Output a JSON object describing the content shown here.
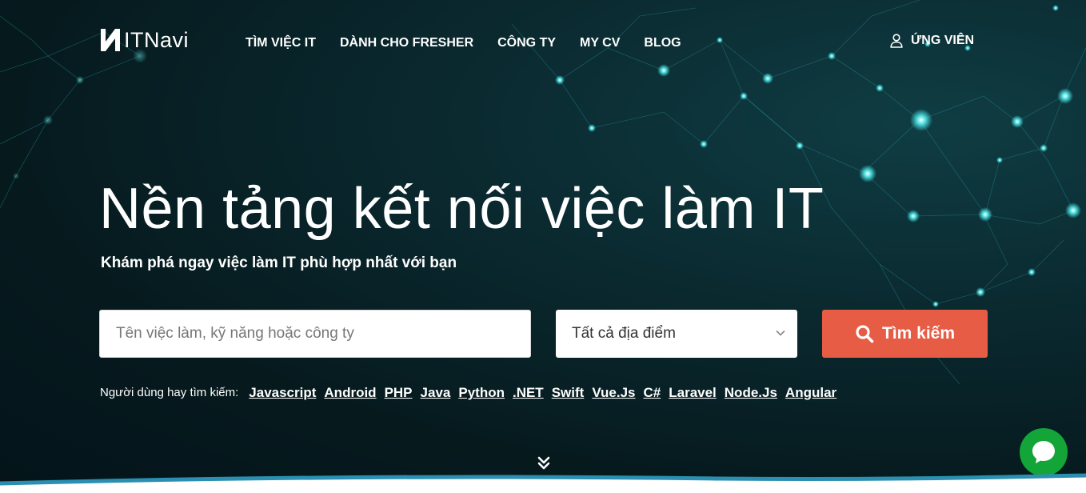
{
  "header": {
    "logo_text": "ITNavi",
    "nav": [
      {
        "label": "TÌM VIỆC IT"
      },
      {
        "label": "DÀNH CHO FRESHER"
      },
      {
        "label": "CÔNG TY"
      },
      {
        "label": "MY CV"
      },
      {
        "label": "BLOG"
      }
    ],
    "user_label": "ỨNG VIÊN"
  },
  "hero": {
    "title": "Nền tảng kết nối việc làm IT",
    "subtitle": "Khám phá ngay việc làm IT phù hợp nhất với bạn"
  },
  "search": {
    "placeholder": "Tên việc làm, kỹ năng hoặc công ty",
    "location_selected": "Tất cả địa điểm",
    "button_label": "Tìm kiếm"
  },
  "popular": {
    "label": "Người dùng hay tìm kiếm:",
    "tags": [
      "Javascript",
      "Android",
      "PHP",
      "Java",
      "Python",
      ".NET",
      "Swift",
      "Vue.Js",
      "C#",
      "Laravel",
      "Node.Js",
      "Angular"
    ]
  },
  "icons": {
    "logo": "itnavi-logo-icon",
    "user": "user-icon",
    "search": "search-icon",
    "chevron": "chevron-down-icon",
    "scroll": "double-chevron-down-icon",
    "chat": "chat-bubble-icon"
  },
  "colors": {
    "background": "#061a1e",
    "accent_button": "#e75c44",
    "network_glow": "#3ff0f0",
    "chat_button": "#13a538",
    "bottom_strip": "#2a8fb0"
  }
}
